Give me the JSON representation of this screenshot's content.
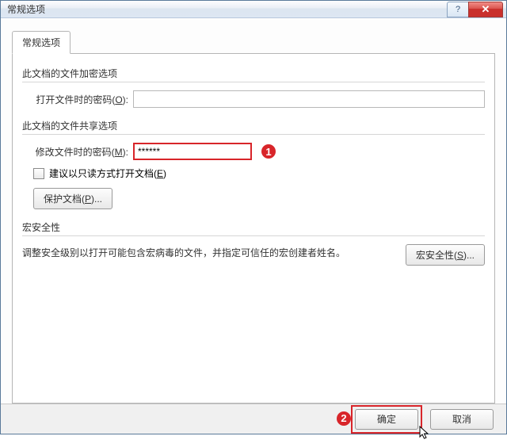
{
  "window": {
    "title": "常规选项",
    "help_label": "?",
    "close_label": "✕"
  },
  "tabs": {
    "general": "常规选项"
  },
  "sections": {
    "encrypt": {
      "title": "此文档的文件加密选项",
      "open_pw_label_prefix": "打开文件时的密码(",
      "open_pw_label_suffix": "):",
      "open_pw_accel": "O",
      "open_pw_value": ""
    },
    "share": {
      "title": "此文档的文件共享选项",
      "modify_pw_label_prefix": "修改文件时的密码(",
      "modify_pw_label_suffix": "):",
      "modify_pw_accel": "M",
      "modify_pw_value": "******",
      "readonly_label_prefix": "建议以只读方式打开文档(",
      "readonly_label_suffix": ")",
      "readonly_accel": "E",
      "protect_btn_prefix": "保护文档(",
      "protect_btn_suffix": ")...",
      "protect_accel": "P"
    },
    "macro": {
      "title": "宏安全性",
      "desc": "调整安全级别以打开可能包含宏病毒的文件，并指定可信任的宏创建者姓名。",
      "macro_btn_prefix": "宏安全性(",
      "macro_btn_suffix": ")...",
      "macro_accel": "S"
    }
  },
  "footer": {
    "ok_label": "确定",
    "cancel_label": "取消"
  },
  "annotations": {
    "one": "1",
    "two": "2"
  }
}
